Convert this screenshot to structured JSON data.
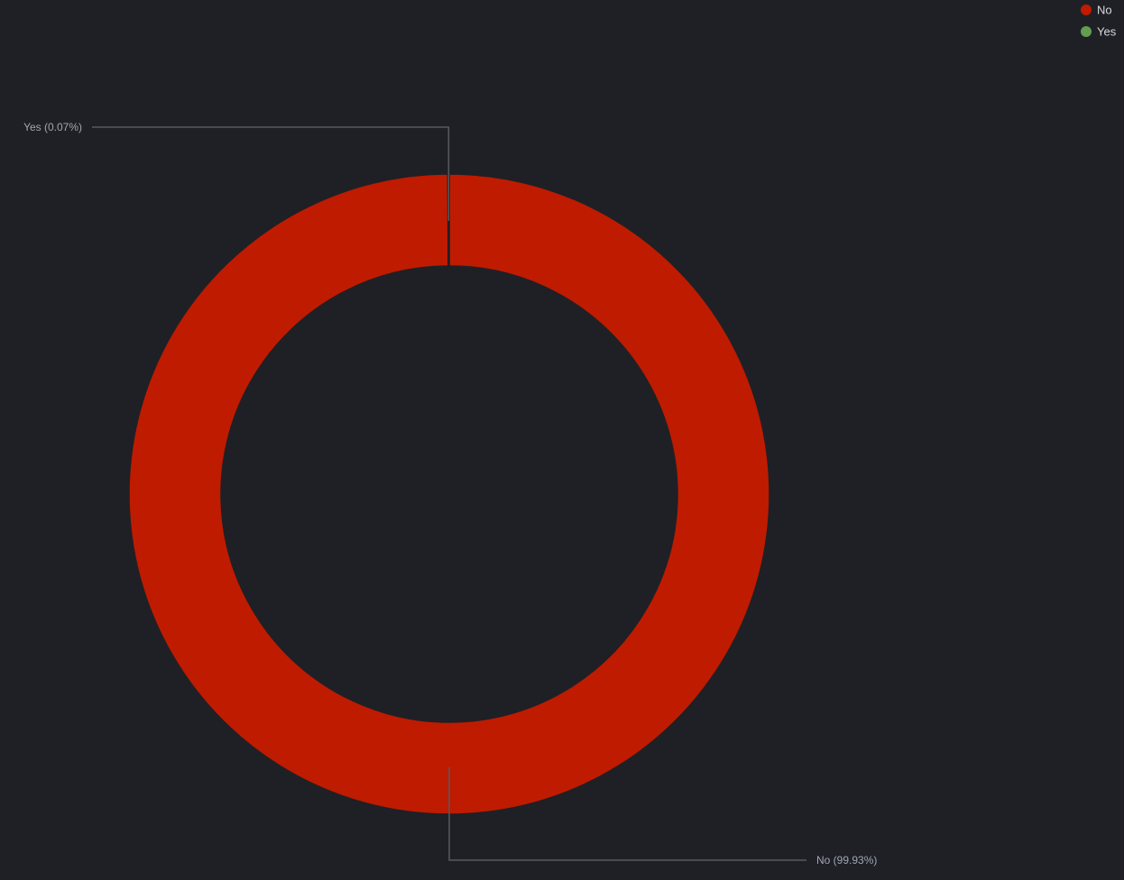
{
  "chart_data": {
    "type": "pie",
    "variant": "donut",
    "categories": [
      "No",
      "Yes"
    ],
    "values": [
      99.93,
      0.07
    ],
    "value_unit": "%",
    "series": [
      {
        "name": "No",
        "value": 99.93,
        "label": "No (99.93%)",
        "color": "#bf1b00"
      },
      {
        "name": "Yes",
        "value": 0.07,
        "label": "Yes (0.07%)",
        "color": "#629e51"
      }
    ],
    "legend": {
      "position": "top-right",
      "items": [
        {
          "label": "No",
          "color": "#bf1b00"
        },
        {
          "label": "Yes",
          "color": "#629e51"
        }
      ]
    },
    "grid": false
  },
  "theme": {
    "background": "#1f2025",
    "legend_text_color": "#d8d9da",
    "callout_text_color": "#9fa7b3",
    "callout_line_color": "#555a61"
  }
}
